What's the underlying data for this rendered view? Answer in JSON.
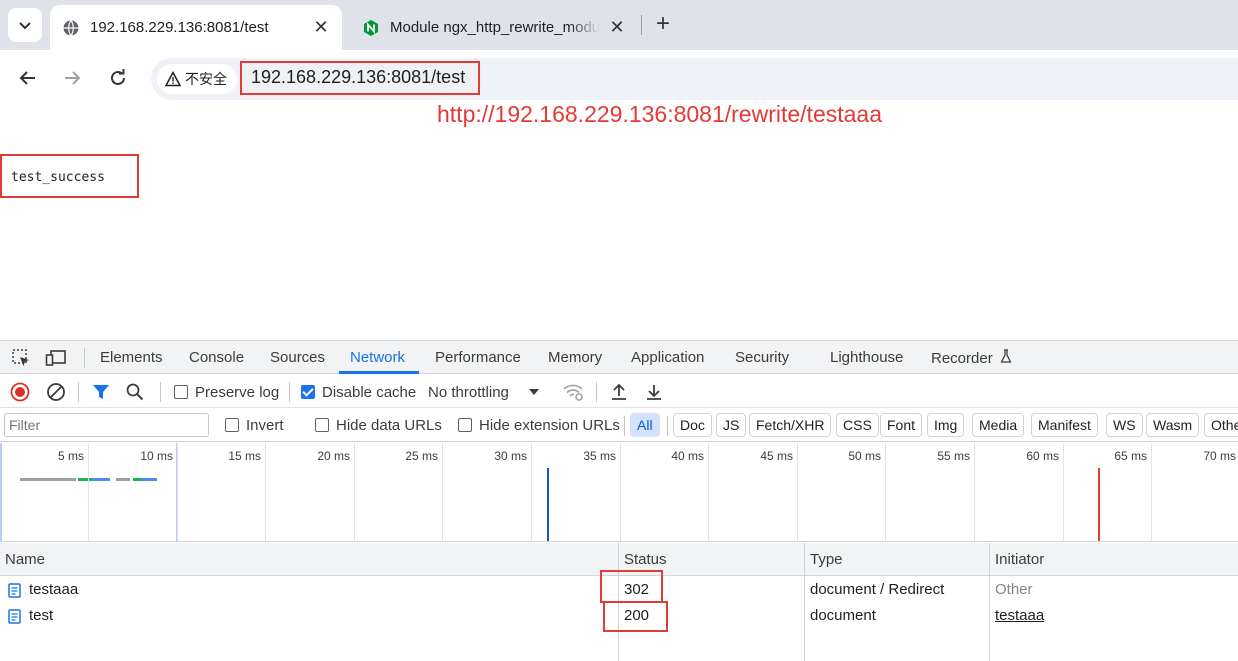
{
  "browser": {
    "tabs": [
      {
        "title": "192.168.229.136:8081/test",
        "active": true,
        "favicon": "globe-icon"
      },
      {
        "title": "Module ngx_http_rewrite_module",
        "active": false,
        "favicon": "nginx-icon"
      }
    ],
    "security_label": "不安全",
    "url": "192.168.229.136:8081/test"
  },
  "page": {
    "annotation": "http://192.168.229.136:8081/rewrite/testaaa",
    "output_text": "test_success"
  },
  "devtools": {
    "tabs": [
      "Elements",
      "Console",
      "Sources",
      "Network",
      "Performance",
      "Memory",
      "Application",
      "Security",
      "Lighthouse",
      "Recorder"
    ],
    "active_tab": "Network",
    "toolbar": {
      "preserve_log": "Preserve log",
      "disable_cache": "Disable cache",
      "throttling": "No throttling"
    },
    "filter": {
      "placeholder": "Filter",
      "invert": "Invert",
      "hide_data_urls": "Hide data URLs",
      "hide_extension_urls": "Hide extension URLs",
      "types": [
        "All",
        "Doc",
        "JS",
        "Fetch/XHR",
        "CSS",
        "Font",
        "Img",
        "Media",
        "Manifest",
        "WS",
        "Wasm",
        "Other"
      ]
    },
    "timeline": {
      "labels": [
        "5 ms",
        "10 ms",
        "15 ms",
        "20 ms",
        "25 ms",
        "30 ms",
        "35 ms",
        "40 ms",
        "45 ms",
        "50 ms",
        "55 ms",
        "60 ms",
        "65 ms",
        "70 ms"
      ],
      "dom_content_loaded_color": "#1a56b8",
      "load_color": "#e53935"
    },
    "table": {
      "headers": {
        "name": "Name",
        "status": "Status",
        "type": "Type",
        "initiator": "Initiator"
      },
      "rows": [
        {
          "name": "testaaa",
          "status": "302",
          "type": "document / Redirect",
          "initiator": "Other"
        },
        {
          "name": "test",
          "status": "200",
          "type": "document",
          "initiator": "testaaa"
        }
      ]
    }
  },
  "colors": {
    "highlight": "#e53935",
    "accent": "#1a73e8"
  }
}
